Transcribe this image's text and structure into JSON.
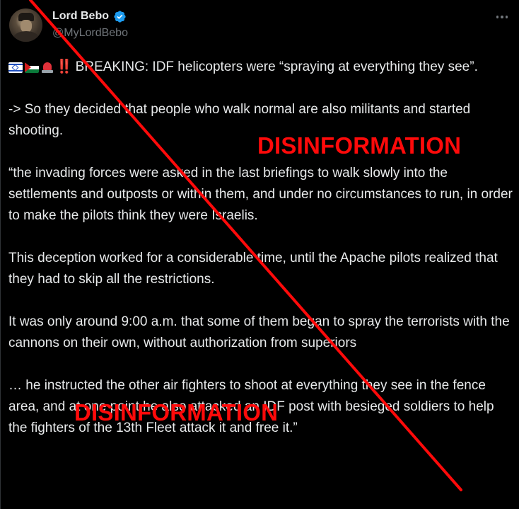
{
  "author": {
    "display_name": "Lord Bebo",
    "handle": "@MyLordBebo",
    "verified": true
  },
  "icons": {
    "avatar": "profile-photo",
    "verified": "verified-badge-icon",
    "more": "more-options-icon",
    "emoji": [
      "israel-flag-icon",
      "palestine-flag-icon",
      "police-siren-icon",
      "double-exclamation-icon"
    ]
  },
  "tweet": {
    "lead_marks": "‼️",
    "paragraphs": [
      "BREAKING: IDF helicopters were “spraying at everything they see”.",
      "-> So they decided that people who walk normal are also militants and started shooting.",
      "“the invading forces were asked in the last briefings to walk slowly into the settlements and outposts or within them, and under no circumstances to run, in order to make the pilots think they were Israelis.",
      "This deception worked for a considerable time, until the Apache pilots realized that they had to skip all the restrictions.",
      "It was only around 9:00 a.m. that some of them began to spray the terrorists with the cannons on their own, without authorization from superiors",
      "… he instructed the other air fighters to shoot at everything they see in the fence area, and at one point he also attacked an IDF post with besieged soldiers to help the fighters of the 13th Fleet attack it and free it.”"
    ]
  },
  "overlay": {
    "label_top": "DISINFORMATION",
    "label_bottom": "DISINFORMATION",
    "color": "#ff0a0a"
  },
  "colors": {
    "background": "#000000",
    "text": "#e7e9ea",
    "secondary_text": "#71767b",
    "verified_blue": "#1d9bf0"
  }
}
